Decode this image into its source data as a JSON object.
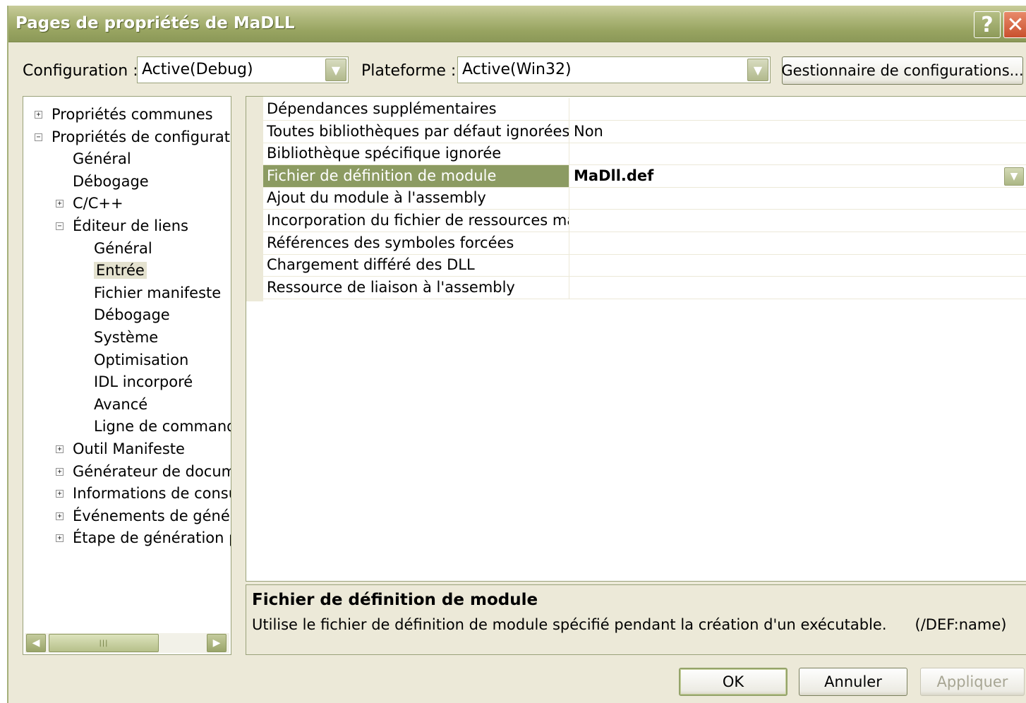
{
  "window": {
    "title": "Pages de propriétés de MaDLL",
    "help_glyph": "?",
    "close_glyph": "✕"
  },
  "toolbar": {
    "configuration_label": "Configuration :",
    "configuration_value": "Active(Debug)",
    "platform_label": "Plateforme :",
    "platform_value": "Active(Win32)",
    "config_manager_button": "Gestionnaire de configurations..."
  },
  "tree": {
    "items": [
      {
        "label": "Propriétés communes",
        "expander": "+"
      },
      {
        "label": "Propriétés de configuration",
        "expander": "−"
      },
      {
        "label": "Général",
        "expander": ""
      },
      {
        "label": "Débogage",
        "expander": ""
      },
      {
        "label": "C/C++",
        "expander": "+"
      },
      {
        "label": "Éditeur de liens",
        "expander": "−"
      },
      {
        "label": "Général",
        "expander": ""
      },
      {
        "label": "Entrée",
        "expander": ""
      },
      {
        "label": "Fichier manifeste",
        "expander": ""
      },
      {
        "label": "Débogage",
        "expander": ""
      },
      {
        "label": "Système",
        "expander": ""
      },
      {
        "label": "Optimisation",
        "expander": ""
      },
      {
        "label": "IDL incorporé",
        "expander": ""
      },
      {
        "label": "Avancé",
        "expander": ""
      },
      {
        "label": "Ligne de commande",
        "expander": ""
      },
      {
        "label": "Outil Manifeste",
        "expander": "+"
      },
      {
        "label": "Générateur de documents XML",
        "expander": "+"
      },
      {
        "label": "Informations de consultation",
        "expander": "+"
      },
      {
        "label": "Événements de génération",
        "expander": "+"
      },
      {
        "label": "Étape de génération personnalisée",
        "expander": "+"
      }
    ],
    "scroll_left": "◀",
    "scroll_right": "▶",
    "scroll_thumb": "|||"
  },
  "grid": {
    "rows": [
      {
        "name": "Dépendances supplémentaires",
        "value": ""
      },
      {
        "name": "Toutes bibliothèques par défaut ignorées",
        "value": "Non"
      },
      {
        "name": "Bibliothèque spécifique ignorée",
        "value": ""
      },
      {
        "name": "Fichier de définition de module",
        "value": "MaDll.def"
      },
      {
        "name": "Ajout du module à l'assembly",
        "value": ""
      },
      {
        "name": "Incorporation du fichier de ressources managées",
        "value": ""
      },
      {
        "name": "Références des symboles forcées",
        "value": ""
      },
      {
        "name": "Chargement différé des DLL",
        "value": ""
      },
      {
        "name": "Ressource de liaison à l'assembly",
        "value": ""
      }
    ]
  },
  "description": {
    "title": "Fichier de définition de module",
    "text": "Utilise le fichier de définition de module spécifié pendant la création d'un exécutable.",
    "switch": "(/DEF:name)"
  },
  "buttons": {
    "ok": "OK",
    "cancel": "Annuler",
    "apply": "Appliquer"
  },
  "colors": {
    "titlebar": "#98a461",
    "selection": "#8c9b62",
    "dialog_bg": "#ece9d8"
  }
}
